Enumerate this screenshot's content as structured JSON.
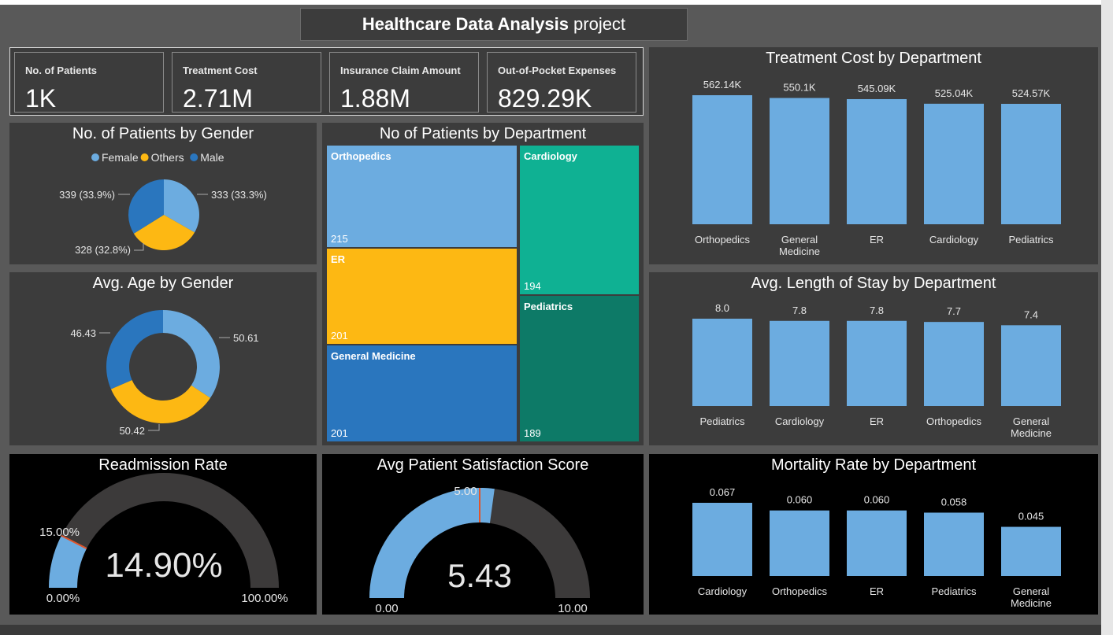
{
  "header": {
    "title_bold": "Healthcare Data Analysis",
    "title_rest": "project"
  },
  "kpis": [
    {
      "label": "No. of Patients",
      "value": "1K"
    },
    {
      "label": "Treatment Cost",
      "value": "2.71M"
    },
    {
      "label": "Insurance Claim Amount",
      "value": "1.88M"
    },
    {
      "label": "Out-of-Pocket Expenses",
      "value": "829.29K"
    }
  ],
  "colors": {
    "blue": "#6cace0",
    "orange": "#fdb813",
    "darkblue": "#2a76be",
    "teal": "#0fb193",
    "darkteal": "#0d7a67",
    "gaugebg": "#3c3a3a",
    "target": "#e0552c"
  },
  "chart_data": [
    {
      "id": "gender_pie",
      "type": "pie",
      "title": "No. of Patients by Gender",
      "legend": [
        "Female",
        "Others",
        "Male"
      ],
      "legend_position": "top-center",
      "categories": [
        "Female",
        "Others",
        "Male"
      ],
      "values": [
        333,
        328,
        339
      ],
      "labels": [
        "333 (33.3%)",
        "328 (32.8%)",
        "339 (33.9%)"
      ],
      "colors": [
        "#6cace0",
        "#fdb813",
        "#2a76be"
      ]
    },
    {
      "id": "age_donut",
      "type": "pie",
      "title": "Avg. Age by Gender",
      "categories": [
        "Female",
        "Others",
        "Male"
      ],
      "values": [
        50.61,
        50.42,
        46.43
      ],
      "labels": [
        "50.61",
        "50.42",
        "46.43"
      ],
      "colors": [
        "#6cace0",
        "#fdb813",
        "#2a76be"
      ]
    },
    {
      "id": "dept_treemap",
      "type": "treemap",
      "title": "No of Patients by Department",
      "categories": [
        "Orthopedics",
        "ER",
        "General Medicine",
        "Cardiology",
        "Pediatrics"
      ],
      "values": [
        215,
        201,
        201,
        194,
        189
      ]
    },
    {
      "id": "cost_bar",
      "type": "bar",
      "title": "Treatment Cost by Department",
      "categories": [
        "Orthopedics",
        "General Medicine",
        "ER",
        "Cardiology",
        "Pediatrics"
      ],
      "values": [
        562.14,
        550.1,
        545.09,
        525.04,
        524.57
      ],
      "labels": [
        "562.14K",
        "550.1K",
        "545.09K",
        "525.04K",
        "524.57K"
      ]
    },
    {
      "id": "stay_bar",
      "type": "bar",
      "title": "Avg. Length of Stay by Department",
      "categories": [
        "Pediatrics",
        "Cardiology",
        "ER",
        "Orthopedics",
        "General Medicine"
      ],
      "values": [
        8.0,
        7.8,
        7.8,
        7.7,
        7.4
      ],
      "labels": [
        "8.0",
        "7.8",
        "7.8",
        "7.7",
        "7.4"
      ]
    },
    {
      "id": "readmission_gauge",
      "type": "gauge",
      "title": "Readmission Rate",
      "value": 14.9,
      "min": 0,
      "max": 100,
      "target": 15,
      "value_label": "14.90%",
      "min_label": "0.00%",
      "max_label": "100.00%",
      "target_label": "15.00%"
    },
    {
      "id": "satisfaction_gauge",
      "type": "gauge",
      "title": "Avg Patient Satisfaction Score",
      "value": 5.43,
      "min": 0,
      "max": 10,
      "target": 5,
      "value_label": "5.43",
      "min_label": "0.00",
      "max_label": "10.00",
      "target_label": "5.00"
    },
    {
      "id": "mortality_bar",
      "type": "bar",
      "title": "Mortality Rate by Department",
      "categories": [
        "Cardiology",
        "Orthopedics",
        "ER",
        "Pediatrics",
        "General Medicine"
      ],
      "values": [
        0.067,
        0.06,
        0.06,
        0.058,
        0.045
      ],
      "labels": [
        "0.067",
        "0.060",
        "0.060",
        "0.058",
        "0.045"
      ]
    }
  ]
}
